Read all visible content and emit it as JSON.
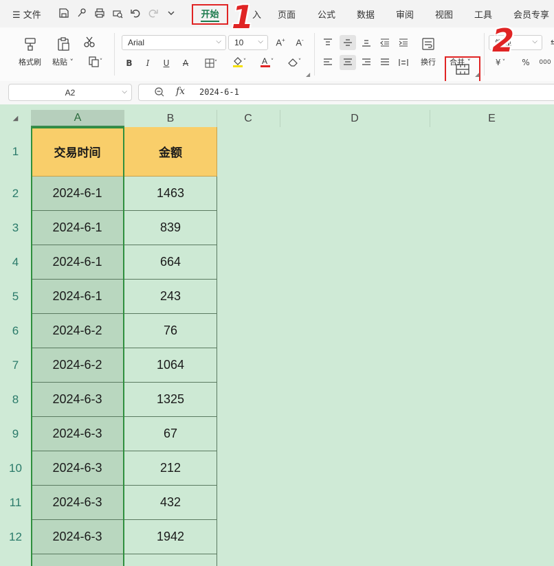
{
  "menu": {
    "file_label": "文件",
    "tabs": [
      "开始",
      "插入",
      "页面",
      "公式",
      "数据",
      "审阅",
      "视图",
      "工具",
      "会员专享"
    ],
    "insert_visible": "入",
    "active_tab": "开始"
  },
  "annotations": {
    "step1": "1",
    "step2": "2"
  },
  "ribbon": {
    "format_painter": "格式刷",
    "paste": "粘贴",
    "font_name": "Arial",
    "font_size": "10",
    "wrap": "换行",
    "merge": "合并",
    "number_format_partial": "常规",
    "percent": "%",
    "currency": "¥"
  },
  "formula_bar": {
    "cell_ref": "A2",
    "fx_label": "fx",
    "value": "2024-6-1"
  },
  "grid": {
    "columns": [
      "A",
      "B",
      "C",
      "D",
      "E"
    ],
    "rows": [
      "1",
      "2",
      "3",
      "4",
      "5",
      "6",
      "7",
      "8",
      "9",
      "10",
      "11",
      "12"
    ],
    "headers": [
      "交易时间",
      "金额"
    ],
    "data": [
      [
        "2024-6-1",
        "1463"
      ],
      [
        "2024-6-1",
        "839"
      ],
      [
        "2024-6-1",
        "664"
      ],
      [
        "2024-6-1",
        "243"
      ],
      [
        "2024-6-2",
        "76"
      ],
      [
        "2024-6-2",
        "1064"
      ],
      [
        "2024-6-3",
        "1325"
      ],
      [
        "2024-6-3",
        "67"
      ],
      [
        "2024-6-3",
        "212"
      ],
      [
        "2024-6-3",
        "432"
      ],
      [
        "2024-6-3",
        "1942"
      ]
    ]
  },
  "colors": {
    "accent_green": "#1c7a4d",
    "highlight_red": "#e02424",
    "header_fill": "#f9ce6a",
    "sheet_bg": "#cfead6"
  }
}
